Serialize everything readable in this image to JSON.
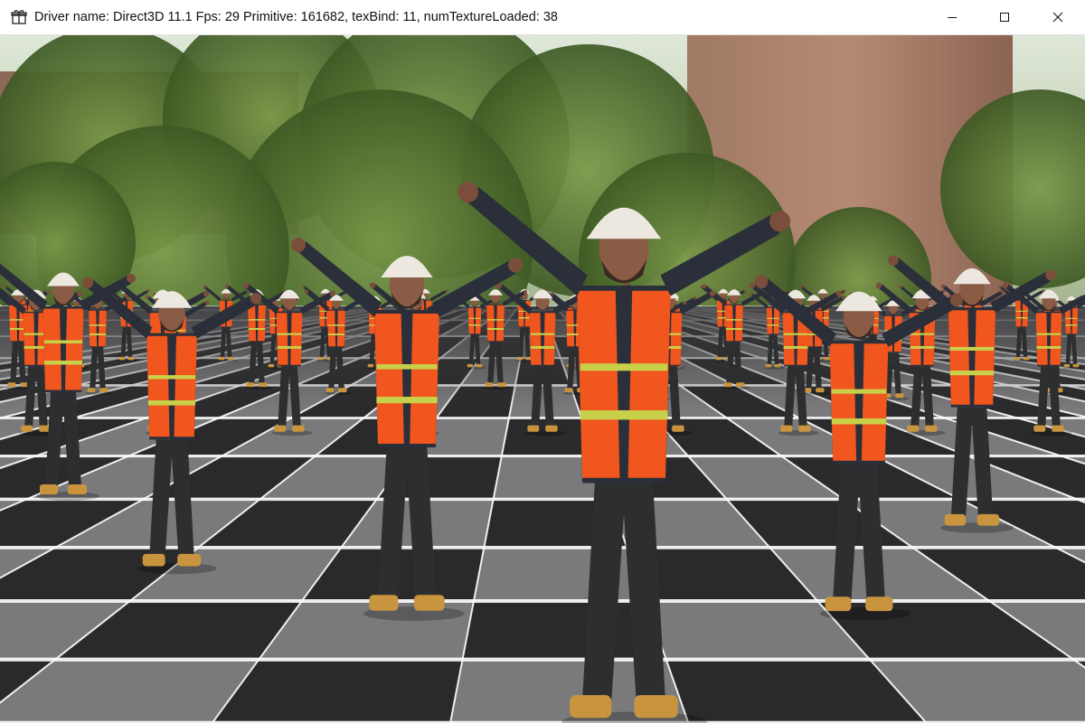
{
  "window": {
    "title": "Driver name: Direct3D 11.1 Fps: 29 Primitive: 161682, texBind: 11, numTextureLoaded: 38",
    "icon": "gift-box-icon",
    "controls": [
      "minimize-icon",
      "maximize-icon",
      "close-icon"
    ]
  },
  "scene": {
    "description_icon": "3d-viewport",
    "colors": {
      "vest": "#f0561e",
      "reflective_stripe": "#c8d04a",
      "helmet": "#ece8df",
      "shirt": "#2b2f3a",
      "pants": "#2d2e30",
      "boots": "#c8953e",
      "tile_dark": "#2a2a2c",
      "tile_light": "#7a7a7d",
      "grid_line": "#ffffff",
      "brick": "#9a6a55",
      "foliage": "#5f7f3a"
    }
  }
}
